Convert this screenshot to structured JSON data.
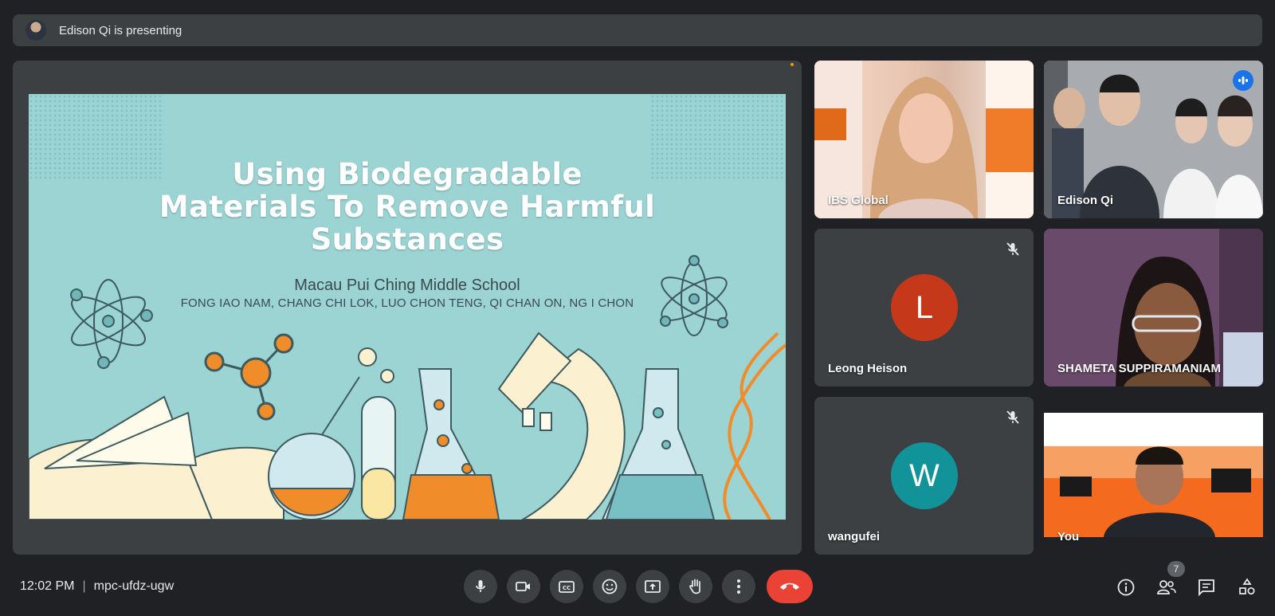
{
  "presenting_banner": {
    "text": "Edison Qi is presenting"
  },
  "slide": {
    "title_lines": [
      "Using Biodegradable",
      "Materials To Remove Harmful",
      "Substances"
    ],
    "school": "Macau Pui Ching Middle School",
    "names": "FONG IAO NAM, CHANG CHI LOK, LUO CHON TENG, QI CHAN ON, NG I CHON"
  },
  "participants": [
    {
      "name": "IBS Global",
      "type": "video"
    },
    {
      "name": "Edison Qi",
      "type": "video",
      "speaking": true
    },
    {
      "name": "Leong Heison",
      "type": "avatar",
      "initial": "L",
      "color": "#c5391a",
      "muted": true
    },
    {
      "name": "SHAMETA SUPPIRAMANIAM",
      "type": "video"
    },
    {
      "name": "wangufei",
      "type": "avatar",
      "initial": "W",
      "color": "#12939a",
      "muted": true
    },
    {
      "name": "You",
      "type": "video"
    }
  ],
  "footer": {
    "time": "12:02 PM",
    "meeting_code": "mpc-ufdz-ugw",
    "people_count": "7"
  },
  "controls": [
    "microphone-icon",
    "camera-icon",
    "captions-icon",
    "emoji-icon",
    "present-screen-icon",
    "raise-hand-icon",
    "more-options-icon",
    "end-call-icon"
  ],
  "right_controls": [
    "info-icon",
    "people-icon",
    "chat-icon",
    "activities-icon"
  ],
  "colors": {
    "background": "#202124",
    "tile": "#3c4043",
    "end_call": "#ea4335",
    "active_outline": "#8ab4f8"
  }
}
